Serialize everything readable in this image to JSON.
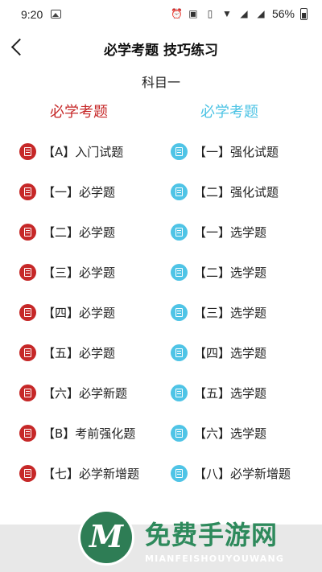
{
  "status_bar": {
    "time": "9:20",
    "battery": "56%",
    "icons": [
      "image-icon",
      "alarm-icon",
      "nfc-icon",
      "vibrate-icon",
      "wifi-icon",
      "signal-4g-icon",
      "signal-g-icon",
      "battery-icon"
    ]
  },
  "header": {
    "title": "必学考题 技巧练习",
    "subject": "科目一"
  },
  "columns": {
    "left_title": "必学考题",
    "right_title": "必学考题"
  },
  "left_items": [
    {
      "label": "【A】入门试题"
    },
    {
      "label": "【一】必学题"
    },
    {
      "label": "【二】必学题"
    },
    {
      "label": "【三】必学题"
    },
    {
      "label": "【四】必学题"
    },
    {
      "label": "【五】必学题"
    },
    {
      "label": "【六】必学新题"
    },
    {
      "label": "【B】考前强化题"
    },
    {
      "label": "【七】必学新增题"
    }
  ],
  "right_items": [
    {
      "label": "【一】强化试题"
    },
    {
      "label": "【二】强化试题"
    },
    {
      "label": "【一】选学题"
    },
    {
      "label": "【二】选学题"
    },
    {
      "label": "【三】选学题"
    },
    {
      "label": "【四】选学题"
    },
    {
      "label": "【五】选学题"
    },
    {
      "label": "【六】选学题"
    },
    {
      "label": "【八】必学新增题"
    }
  ],
  "watermark": {
    "cn": "免费手游网",
    "en": "MIANFEISHOUYOUWANG",
    "logo_letter": "M"
  },
  "colors": {
    "left_accent": "#c62828",
    "right_accent": "#4fc4e6",
    "brand_green": "#2e8a5c"
  }
}
